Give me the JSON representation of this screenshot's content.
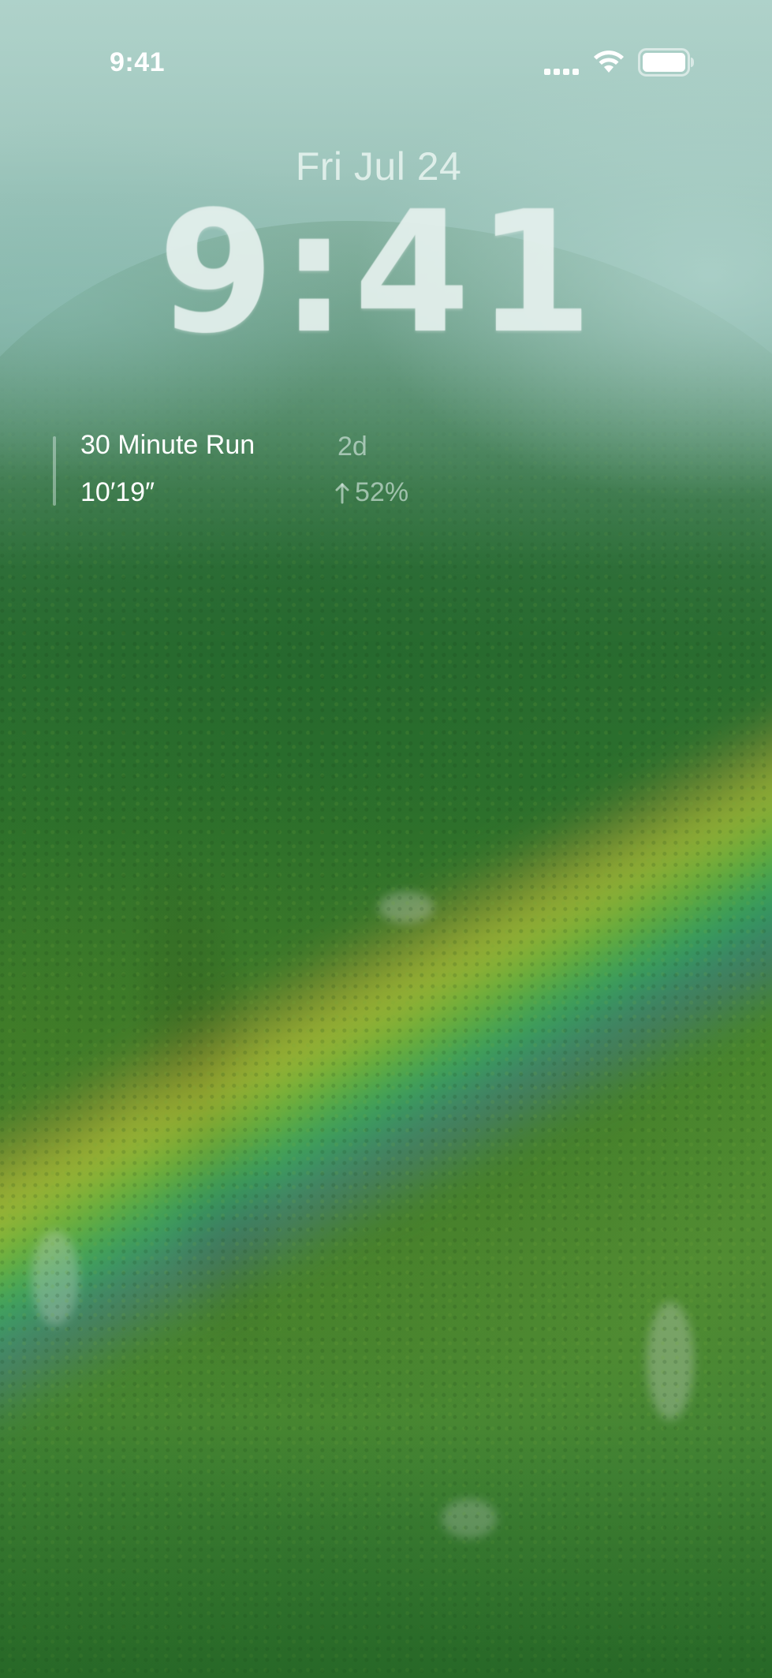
{
  "status_bar": {
    "time": "9:41",
    "icons": [
      "cell-signal-icon",
      "wifi-icon",
      "battery-icon"
    ]
  },
  "lock_screen": {
    "date": "Fri Jul 24",
    "time": "9:41"
  },
  "workout_widget": {
    "title": "30 Minute Run",
    "age": "2d",
    "pace": "10′19″",
    "change_icon": "up-arrow-icon",
    "change": "52%"
  },
  "colors": {
    "text_primary": "#ffffff",
    "text_secondary": "#e1f0eb",
    "mist": "#a9cec6",
    "foliage": "#357c2e"
  }
}
